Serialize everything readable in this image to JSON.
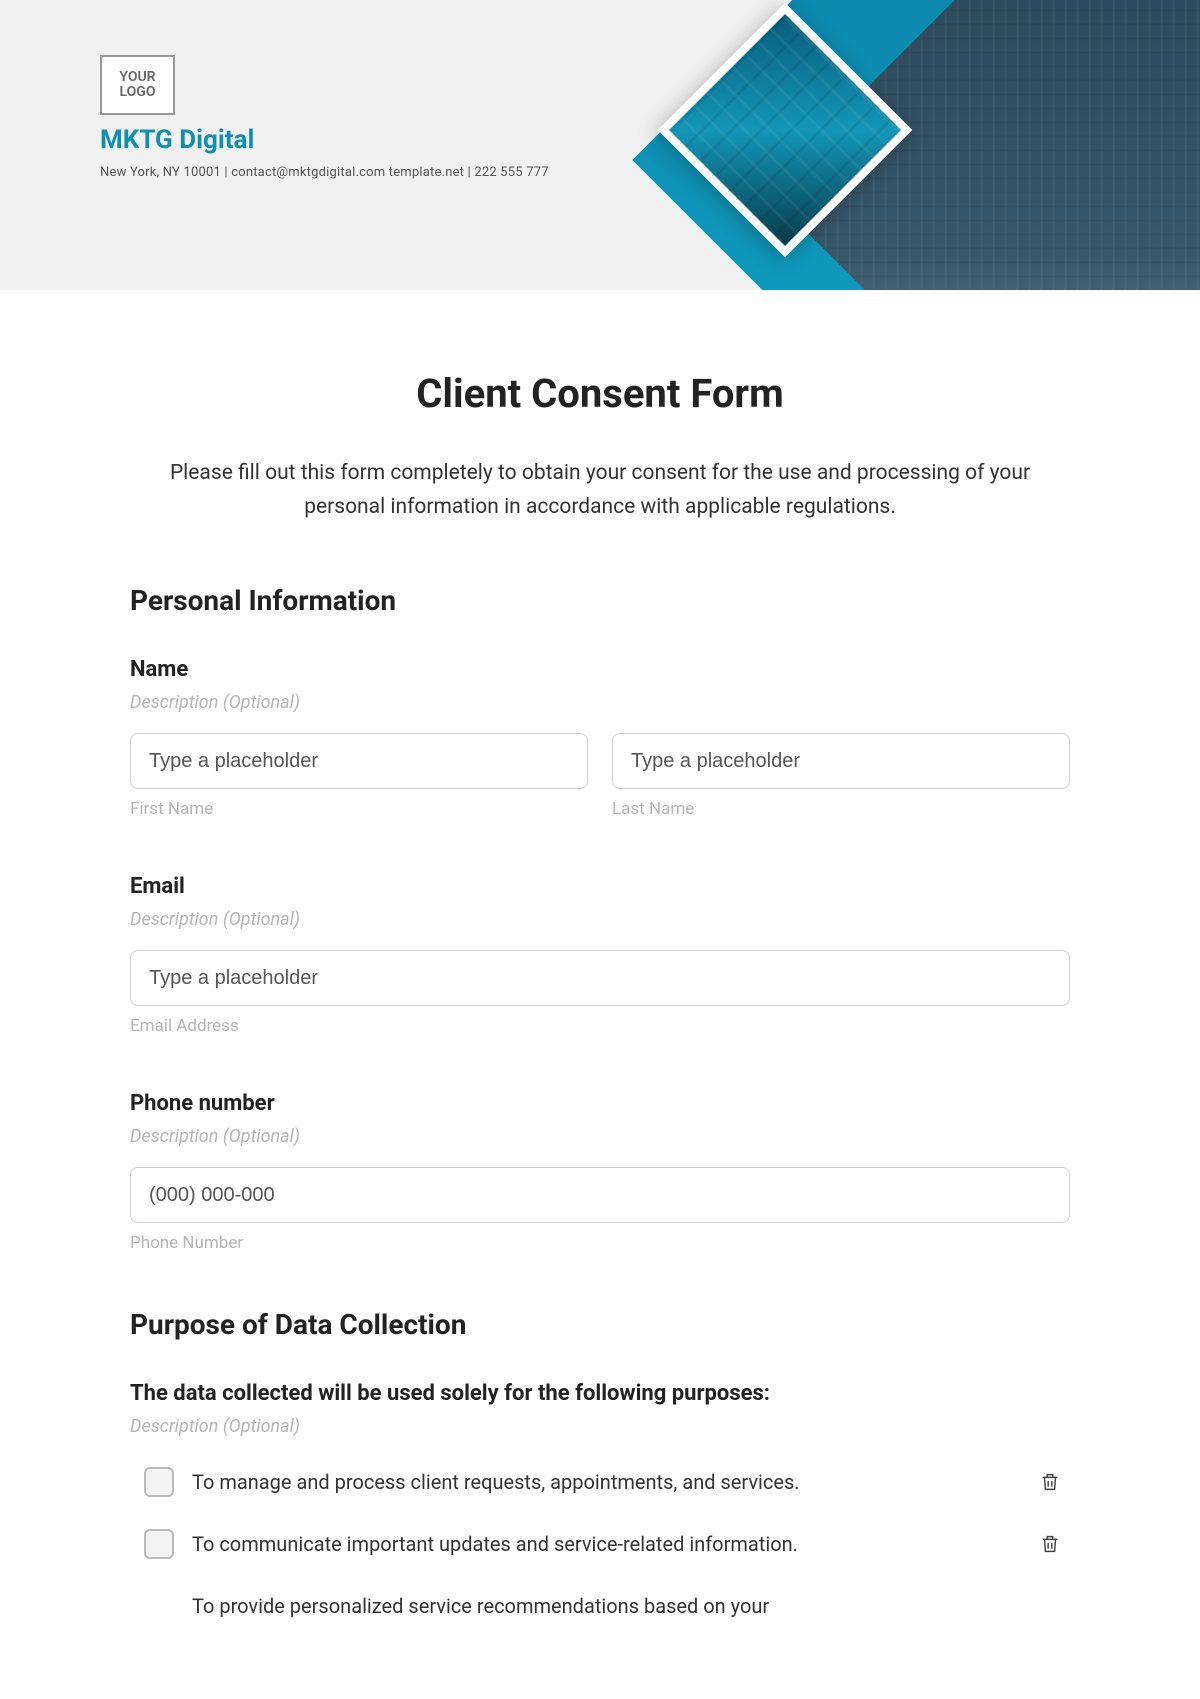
{
  "header": {
    "logo_text": "YOUR LOGO",
    "brand": "MKTG Digital",
    "contact": "New York, NY 10001 | contact@mktgdigital.com   template.net | 222 555 777"
  },
  "form": {
    "title": "Client Consent Form",
    "intro": "Please fill out this form completely to obtain your consent for the use and processing of your personal information in accordance with applicable regulations.",
    "sections": {
      "personal": {
        "heading": "Personal Information",
        "name": {
          "label": "Name",
          "desc": "Description (Optional)",
          "first_placeholder": "Type a placeholder",
          "first_sub": "First Name",
          "last_placeholder": "Type a placeholder",
          "last_sub": "Last Name"
        },
        "email": {
          "label": "Email",
          "desc": "Description (Optional)",
          "placeholder": "Type a placeholder",
          "sub": "Email Address"
        },
        "phone": {
          "label": "Phone number",
          "desc": "Description (Optional)",
          "placeholder": "(000) 000-000",
          "sub": "Phone Number"
        }
      },
      "purpose": {
        "heading": "Purpose of Data Collection",
        "statement": "The data collected will be used solely for the following purposes:",
        "desc": "Description (Optional)",
        "options": [
          "To manage and process client requests, appointments, and services.",
          "To communicate important updates and service-related information.",
          "To provide personalized service recommendations based on your"
        ]
      }
    }
  }
}
